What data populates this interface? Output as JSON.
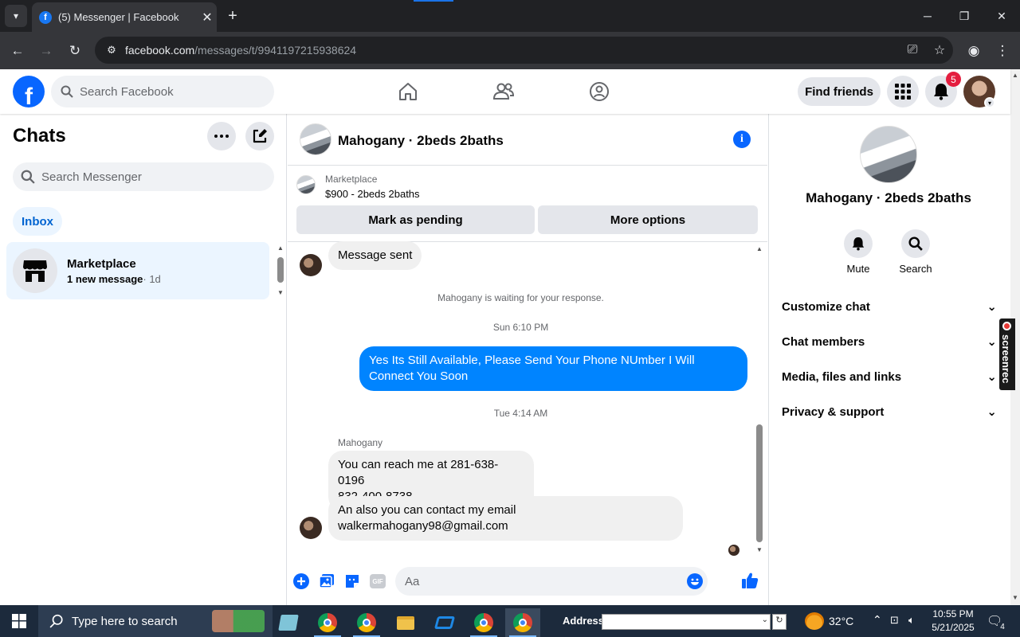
{
  "browser": {
    "tab_title": "(5) Messenger | Facebook",
    "tab_favicon": "f",
    "url_main": "facebook.com",
    "url_path": "/messages/t/9941197215938624"
  },
  "header": {
    "search_placeholder": "Search Facebook",
    "find_friends": "Find friends",
    "notification_count": "5"
  },
  "chats": {
    "title": "Chats",
    "search_placeholder": "Search Messenger",
    "inbox_label": "Inbox",
    "items": [
      {
        "name": "Marketplace",
        "preview": "1 new message",
        "time": "· 1d"
      }
    ]
  },
  "conversation": {
    "title": "Mahogany · 2beds 2baths",
    "marketplace_label": "Marketplace",
    "listing": "$900 - 2beds 2baths",
    "mark_pending": "Mark as pending",
    "more_options": "More options",
    "messages": {
      "sent_notice": "Message sent",
      "waiting": "Mahogany is waiting for your response.",
      "time1": "Sun 6:10 PM",
      "outgoing1": "Yes Its Still Available, Please Send Your Phone NUmber I Will Connect You Soon",
      "time2": "Tue 4:14 AM",
      "sender": "Mahogany",
      "incoming1_line1": "You can reach me at 281-638-0196",
      "incoming1_line2": "832-400-8738",
      "incoming2_line1": "An also you can contact my email",
      "incoming2_line2": "walkermahogany98@gmail.com"
    },
    "composer_placeholder": "Aa",
    "gif_label": "GIF"
  },
  "details": {
    "name": "Mahogany · 2beds 2baths",
    "mute": "Mute",
    "search": "Search",
    "sections": [
      "Customize chat",
      "Chat members",
      "Media, files and links",
      "Privacy & support"
    ]
  },
  "overlay": {
    "screenrec": "screenrec"
  },
  "taskbar": {
    "search_placeholder": "Type here to search",
    "address_label": "Address",
    "temperature": "32°C",
    "time": "10:55 PM",
    "date": "5/21/2025",
    "notification_count": "4"
  },
  "colors": {
    "facebook_blue": "#0866ff",
    "messenger_blue": "#0084ff",
    "badge_red": "#e41e3f"
  }
}
